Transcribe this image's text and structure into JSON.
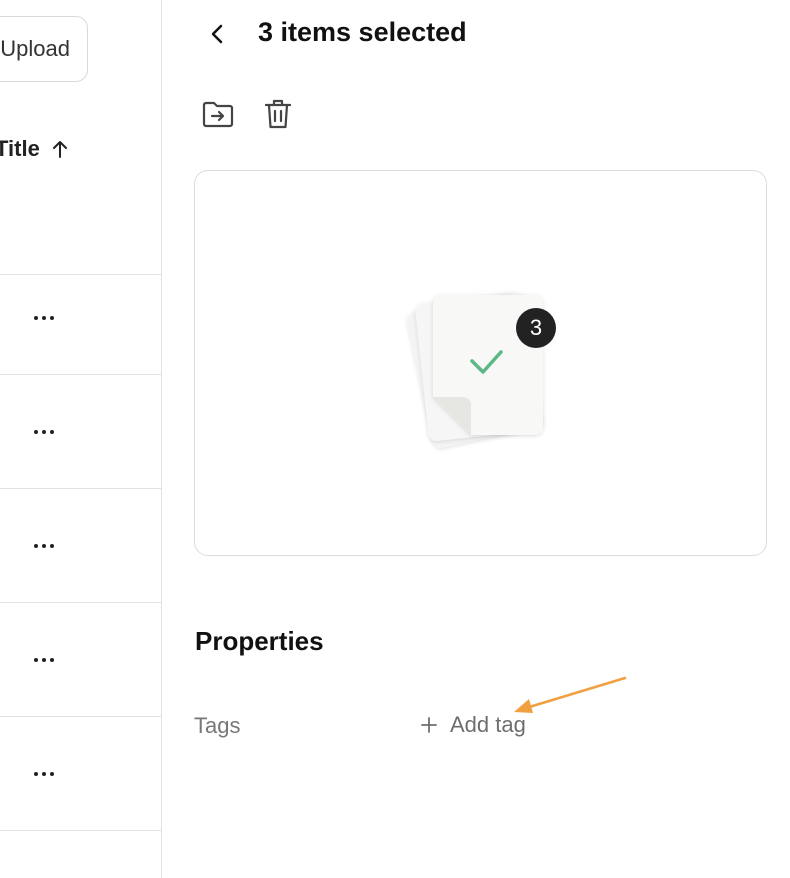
{
  "list": {
    "upload_label": "Upload",
    "title_column_label": "Title",
    "sort_icon": "arrow-up-icon",
    "row_action_icon": "more-horizontal-icon"
  },
  "detail": {
    "back_icon": "chevron-left-icon",
    "selection_title": "3 items selected",
    "toolbar": {
      "move_icon": "folder-move-icon",
      "delete_icon": "trash-icon"
    },
    "preview": {
      "selected_count": "3",
      "check_icon": "checkmark-icon"
    },
    "properties": {
      "heading": "Properties",
      "tags_label": "Tags",
      "add_tag_label": "Add tag",
      "add_icon": "plus-icon"
    }
  },
  "colors": {
    "check": "#5cb886",
    "badge": "#222222",
    "annotation_arrow": "#f0a040",
    "border": "#dcdcdc"
  }
}
